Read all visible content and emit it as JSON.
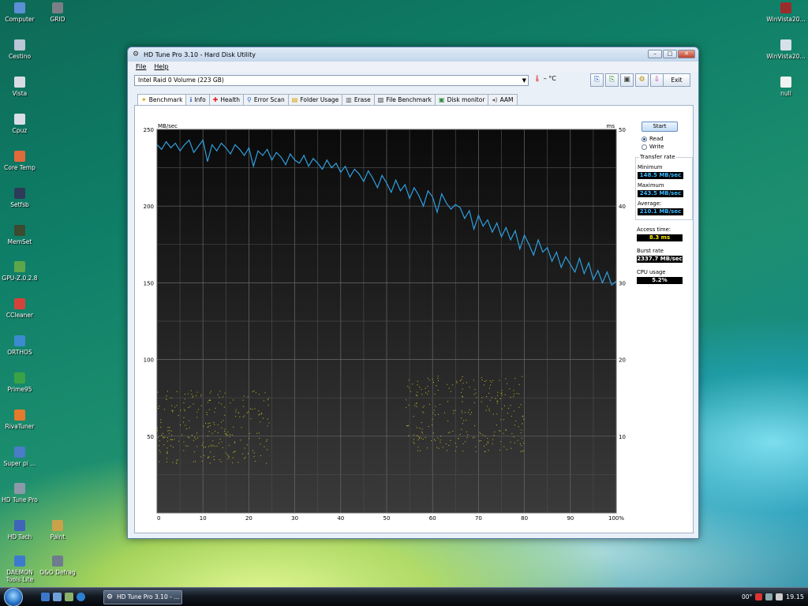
{
  "desktop": {
    "left_icons": [
      {
        "label": "Computer",
        "color": "#5d8fd6"
      },
      {
        "label": "GRID",
        "color": "#7a7f86"
      },
      {
        "label": "Cestino",
        "color": "#b9c6d6"
      },
      {
        "label": "Vista",
        "color": "#d8dde3"
      },
      {
        "label": "Cpuz",
        "color": "#d9dee6"
      },
      {
        "label": "Core Temp",
        "color": "#e06a3a"
      },
      {
        "label": "Setfsb",
        "color": "#2d3b58"
      },
      {
        "label": "MemSet",
        "color": "#3c4a2f"
      },
      {
        "label": "GPU-Z.0.2.8",
        "color": "#5fa64a"
      },
      {
        "label": "CCleaner",
        "color": "#d4433a"
      },
      {
        "label": "ORTHOS",
        "color": "#3b8bd0"
      },
      {
        "label": "Prime95",
        "color": "#3aa246"
      },
      {
        "label": "RivaTuner",
        "color": "#e37a2c"
      },
      {
        "label": "Super pi ...",
        "color": "#4a7cc8"
      },
      {
        "label": "HD Tune Pro",
        "color": "#8c99aa"
      },
      {
        "label": "HD Tach",
        "color": "#3f64b8"
      },
      {
        "label": "Paint",
        "color": "#c9a24a"
      },
      {
        "label": "DAEMON Tools Lite",
        "color": "#3c7ad0"
      },
      {
        "label": "O&O Defrag",
        "color": "#6e7c8d"
      }
    ],
    "right_icons": [
      {
        "label": "WinVista20...",
        "color": "#9b2c2c"
      },
      {
        "label": "WinVista20...",
        "color": "#d8e0ea"
      },
      {
        "label": "null",
        "color": "#f2f2f2"
      }
    ]
  },
  "window": {
    "title": "HD Tune Pro 3.10 - Hard Disk Utility",
    "menu": [
      "File",
      "Help"
    ],
    "drive": "Intel  Raid 0 Volume (223 GB)",
    "temperature": "– °C",
    "exit_label": "Exit",
    "tabs": [
      {
        "label": "Benchmark",
        "icon": "✦",
        "icon_color": "#d6a100"
      },
      {
        "label": "Info",
        "icon": "ℹ",
        "icon_color": "#2a6bc1"
      },
      {
        "label": "Health",
        "icon": "✚",
        "icon_color": "#d22"
      },
      {
        "label": "Error Scan",
        "icon": "⚲",
        "icon_color": "#2a6bc1"
      },
      {
        "label": "Folder Usage",
        "icon": "▤",
        "icon_color": "#d8a300"
      },
      {
        "label": "Erase",
        "icon": "▥",
        "icon_color": "#555"
      },
      {
        "label": "File Benchmark",
        "icon": "▧",
        "icon_color": "#444"
      },
      {
        "label": "Disk monitor",
        "icon": "▣",
        "icon_color": "#2e8b3a"
      },
      {
        "label": "AAM",
        "icon": "◂)",
        "icon_color": "#666"
      }
    ],
    "toolbar_icons": [
      {
        "name": "copy-info-icon",
        "glyph": "⎘",
        "color": "#2a6bc1"
      },
      {
        "name": "copy-screenshot-icon",
        "glyph": "⎘",
        "color": "#2e8b3a"
      },
      {
        "name": "save-icon",
        "glyph": "▣",
        "color": "#444"
      },
      {
        "name": "options-icon",
        "glyph": "⚙",
        "color": "#b08a00"
      },
      {
        "name": "download-icon",
        "glyph": "⇩",
        "color": "#b030b0"
      }
    ],
    "side_panel": {
      "start_label": "Start",
      "read_label": "Read",
      "write_label": "Write",
      "transfer_rate_title": "Transfer rate",
      "minimum_label": "Minimum",
      "minimum_value": "148.5 MB/sec",
      "maximum_label": "Maximum",
      "maximum_value": "243.5 MB/sec",
      "average_label": "Average:",
      "average_value": "210.1 MB/sec",
      "access_time_label": "Access time:",
      "access_time_value": "8.3 ms",
      "burst_rate_label": "Burst rate",
      "burst_rate_value": "2337.7 MB/sec",
      "cpu_usage_label": "CPU usage",
      "cpu_usage_value": "5.2%"
    }
  },
  "chart_data": {
    "type": "line",
    "left_unit": "MB/sec",
    "right_unit": "ms",
    "y_left_ticks": [
      "250",
      "200",
      "150",
      "100",
      "50"
    ],
    "y_right_ticks": [
      "50",
      "40",
      "30",
      "20",
      "10"
    ],
    "x_ticks": [
      "0",
      "10",
      "20",
      "30",
      "40",
      "50",
      "60",
      "70",
      "80",
      "90",
      "100%"
    ],
    "ylim": [
      0,
      250
    ],
    "y2lim": [
      0,
      50
    ],
    "xlim": [
      0,
      100
    ],
    "grid": true,
    "line_color": "#2f9fe0",
    "scatter_color": "#c8c020",
    "series": [
      {
        "values_x": [
          0,
          1,
          2,
          3,
          4,
          5,
          6,
          7,
          8,
          9,
          10,
          11,
          12,
          13,
          14,
          15,
          16,
          17,
          18,
          19,
          20,
          21,
          22,
          23,
          24,
          25,
          26,
          27,
          28,
          29,
          30,
          31,
          32,
          33,
          34,
          35,
          36,
          37,
          38,
          39,
          40,
          41,
          42,
          43,
          44,
          45,
          46,
          47,
          48,
          49,
          50,
          51,
          52,
          53,
          54,
          55,
          56,
          57,
          58,
          59,
          60,
          61,
          62,
          63,
          64,
          65,
          66,
          67,
          68,
          69,
          70,
          71,
          72,
          73,
          74,
          75,
          76,
          77,
          78,
          79,
          80,
          81,
          82,
          83,
          84,
          85,
          86,
          87,
          88,
          89,
          90,
          91,
          92,
          93,
          94,
          95,
          96,
          97,
          98,
          99,
          100
        ],
        "values_y": [
          240,
          237,
          242,
          238,
          241,
          236,
          240,
          243,
          235,
          239,
          243,
          229,
          240,
          236,
          241,
          238,
          234,
          240,
          237,
          233,
          238,
          226,
          236,
          233,
          237,
          230,
          235,
          232,
          227,
          234,
          230,
          228,
          233,
          226,
          231,
          228,
          224,
          230,
          225,
          228,
          222,
          226,
          219,
          224,
          221,
          216,
          223,
          218,
          212,
          220,
          215,
          209,
          217,
          210,
          214,
          205,
          212,
          207,
          200,
          210,
          206,
          196,
          208,
          202,
          198,
          201,
          199,
          192,
          197,
          185,
          194,
          187,
          191,
          183,
          189,
          180,
          186,
          178,
          184,
          172,
          181,
          175,
          168,
          178,
          170,
          173,
          164,
          170,
          160,
          167,
          162,
          157,
          166,
          156,
          163,
          152,
          158,
          150,
          157,
          148.5,
          151
        ]
      }
    ],
    "access_points_ms": [
      {
        "x_range": [
          0,
          25
        ],
        "y_range_ms": [
          6.5,
          16
        ]
      },
      {
        "x_range": [
          54,
          80
        ],
        "y_range_ms": [
          8,
          18
        ]
      }
    ]
  },
  "taskbar": {
    "task_label": "HD Tune Pro 3.10 - ...",
    "tray_temp": "00°",
    "clock": "19.15"
  }
}
